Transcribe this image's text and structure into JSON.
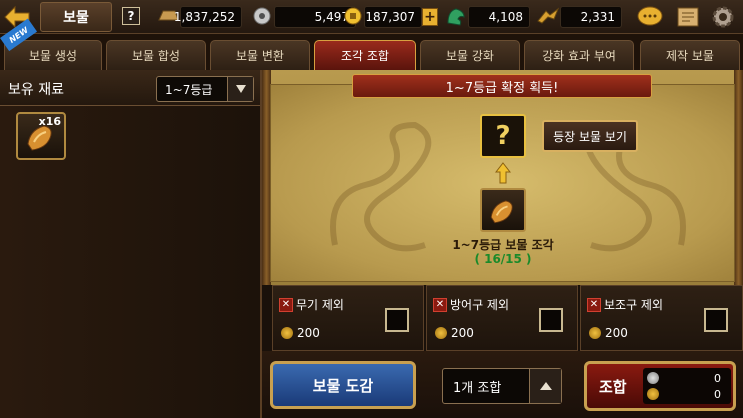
{
  "header": {
    "title": "보물",
    "help": "?",
    "resources": [
      {
        "icon": "ingot-icon",
        "value": "1,837,252"
      },
      {
        "icon": "silver-coin-icon",
        "value": "5,497"
      },
      {
        "icon": "gold-coin-icon",
        "value": "187,307"
      },
      {
        "icon": "jade-dragon-icon",
        "value": "4,108"
      },
      {
        "icon": "dragon-emblem-icon",
        "value": "2,331"
      }
    ]
  },
  "tabs": [
    "보물 생성",
    "보물 합성",
    "보물 변환",
    "조각 조합",
    "보물 강화",
    "강화 효과 부여",
    "제작 보물"
  ],
  "active_tab": 3,
  "new_badge": "NEW",
  "left": {
    "title": "보유 재료",
    "grade_filter": "1~7등급",
    "inventory": [
      {
        "icon": "fragment-icon",
        "count": "x16"
      }
    ]
  },
  "main": {
    "banner": "1~7등급 확정 획득!",
    "result": "?",
    "show_button": "등장 보물 보기",
    "fragment_label": "1~7등급 보물 조각",
    "fragment_count": "( 16/15 )"
  },
  "exclusions": [
    {
      "label": "무기 제외",
      "cost": "200"
    },
    {
      "label": "방어구 제외",
      "cost": "200"
    },
    {
      "label": "보조구 제외",
      "cost": "200"
    }
  ],
  "bottom": {
    "dex_button": "보물 도감",
    "quantity": "1개 조합",
    "combine_button": "조합",
    "costs": [
      {
        "icon": "silver-coin-icon",
        "value": "0"
      },
      {
        "icon": "gold-coin-icon",
        "value": "0"
      }
    ]
  }
}
